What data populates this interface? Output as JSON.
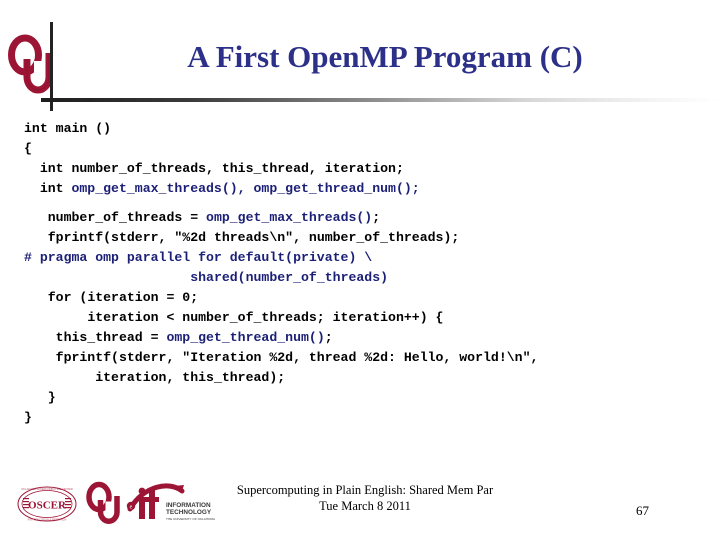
{
  "slide": {
    "title": "A First OpenMP Program (C)",
    "page_number": "67",
    "title_color": "#2c3088",
    "accent_crimson": "#9d1535",
    "code_keyword_color": "#1b1f76"
  },
  "logos": {
    "header_logo": "ou-logo",
    "oscer_logo_text": "OSCER",
    "ou_logo_text": "OU",
    "ouit_logo_text": "it",
    "ouit_line1": "INFORMATION",
    "ouit_line2": "TECHNOLOGY",
    "ouit_line3": "THE UNIVERSITY OF OKLAHOMA"
  },
  "code": {
    "lines": [
      {
        "indent": 0,
        "segments": [
          {
            "text": "int main ()",
            "style": "plain"
          }
        ]
      },
      {
        "indent": 0,
        "segments": [
          {
            "text": "{",
            "style": "plain"
          }
        ]
      },
      {
        "indent": 2,
        "segments": [
          {
            "text": "int number_of_threads, this_thread, iteration;",
            "style": "plain"
          }
        ]
      },
      {
        "indent": 2,
        "segments": [
          {
            "text": "int ",
            "style": "plain"
          },
          {
            "text": "omp_get_max_threads(), omp_get_thread_num();",
            "style": "omp"
          }
        ]
      },
      {
        "blank": true
      },
      {
        "indent": 3,
        "segments": [
          {
            "text": "number_of_threads = ",
            "style": "plain"
          },
          {
            "text": "omp_get_max_threads()",
            "style": "omp"
          },
          {
            "text": ";",
            "style": "plain"
          }
        ]
      },
      {
        "indent": 3,
        "segments": [
          {
            "text": "fprintf(stderr, \"%2d threads\\n\", number_of_threads);",
            "style": "plain"
          }
        ]
      },
      {
        "indent": 0,
        "segments": [
          {
            "text": "# pragma omp parallel for default(private) \\",
            "style": "omp"
          }
        ]
      },
      {
        "indent": 21,
        "segments": [
          {
            "text": "shared(number_of_threads)",
            "style": "omp"
          }
        ]
      },
      {
        "indent": 3,
        "segments": [
          {
            "text": "for (iteration = 0;",
            "style": "plain"
          }
        ]
      },
      {
        "indent": 8,
        "segments": [
          {
            "text": "iteration < number_of_threads; iteration++) {",
            "style": "plain"
          }
        ]
      },
      {
        "indent": 4,
        "segments": [
          {
            "text": "this_thread = ",
            "style": "plain"
          },
          {
            "text": "omp_get_thread_num()",
            "style": "omp"
          },
          {
            "text": ";",
            "style": "plain"
          }
        ]
      },
      {
        "indent": 4,
        "segments": [
          {
            "text": "fprintf(stderr, \"Iteration %2d, thread %2d: Hello, world!\\n\",",
            "style": "plain"
          }
        ]
      },
      {
        "indent": 9,
        "segments": [
          {
            "text": "iteration, this_thread);",
            "style": "plain"
          }
        ]
      },
      {
        "indent": 3,
        "segments": [
          {
            "text": "}",
            "style": "plain"
          }
        ]
      },
      {
        "indent": 0,
        "segments": [
          {
            "text": "}",
            "style": "plain"
          }
        ]
      }
    ]
  },
  "footer": {
    "line1": "Supercomputing in Plain English: Shared Mem Par",
    "line2": "Tue March 8 2011"
  }
}
